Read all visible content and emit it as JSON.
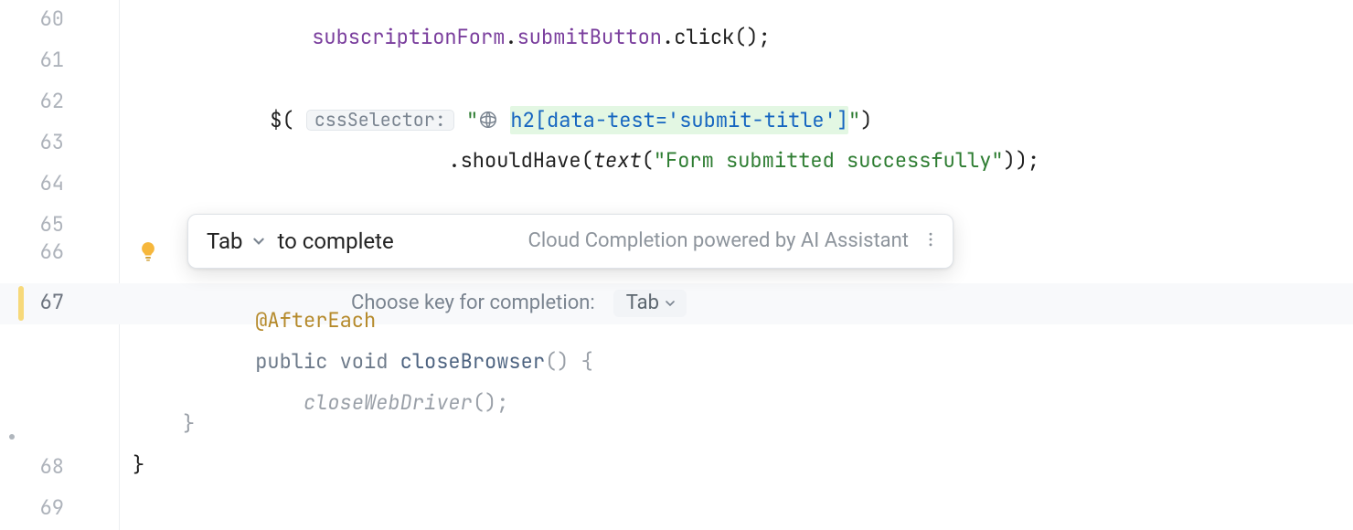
{
  "gutter": {
    "lines": [
      "60",
      "61",
      "62",
      "63",
      "64",
      "65",
      "66",
      "67",
      "68",
      "69"
    ]
  },
  "code": {
    "l60": {
      "a": "subscriptionForm",
      "b": ".",
      "c": "submitButton",
      "d": ".click();"
    },
    "l62": {
      "pre": "$( ",
      "inlay": "cssSelector:",
      "space": " ",
      "q1": "\"",
      "sel": "h2[data-test='submit-title']",
      "q2": "\"",
      "tail": ")"
    },
    "l63": {
      "indent": "                ",
      "a": ".shouldHave(",
      "it": "text",
      "b": "(",
      "str": "\"Form submitted successfully\"",
      "c": "));"
    },
    "l67": {
      "annotation": "@AfterEach"
    },
    "l_pub": {
      "kw1": "public",
      "sp1": " ",
      "kw2": "void",
      "sp2": " ",
      "method": "closeBrowser",
      "tail": "() {"
    },
    "l_cwd": {
      "indent": "    ",
      "call": "closeWebDriver",
      "tail": "();"
    },
    "l_brace1": "}",
    "l_brace2": "}"
  },
  "popup": {
    "key": "Tab",
    "to_complete": "to complete",
    "cloud": "Cloud Completion powered by AI Assistant"
  },
  "config": {
    "label": "Choose key for completion:",
    "value": "Tab"
  }
}
